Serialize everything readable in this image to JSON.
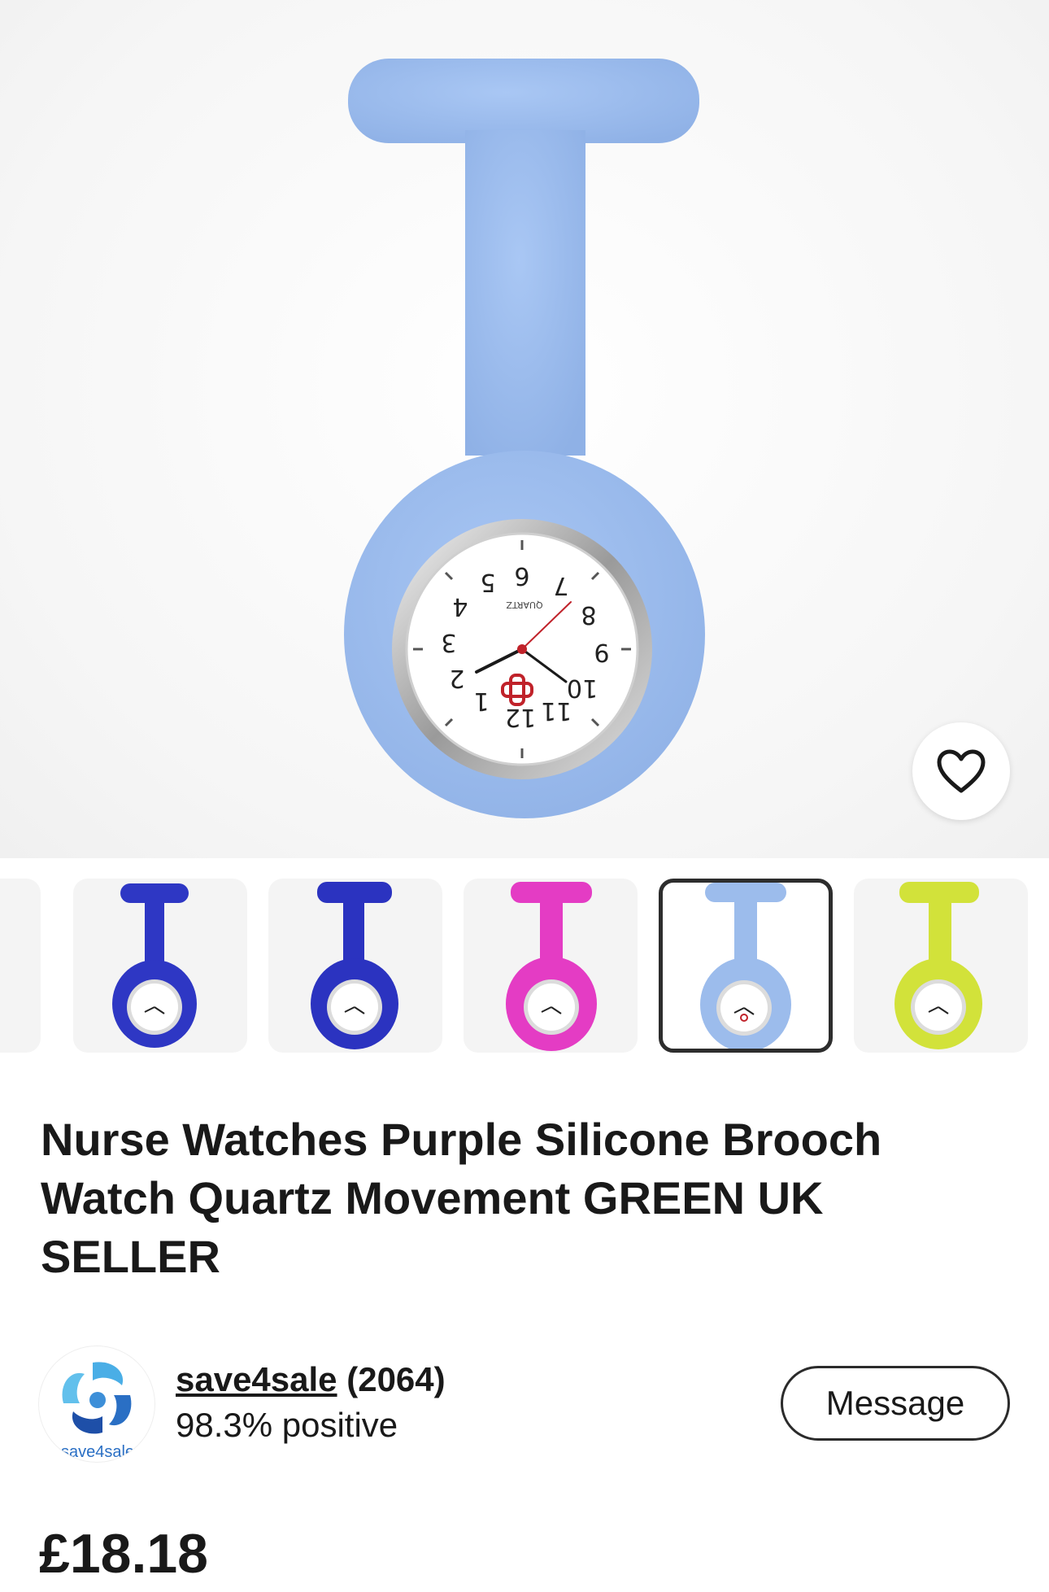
{
  "listing": {
    "title": "Nurse Watches Purple Silicone Brooch Watch Quartz Movement GREEN UK SELLER",
    "price": "£18.18"
  },
  "seller": {
    "name": "save4sale",
    "feedback_count": "(2064)",
    "positive": "98.3% positive",
    "logo_text": "save4sale"
  },
  "actions": {
    "message_label": "Message",
    "favorite_icon": "heart-icon"
  },
  "watch_face": {
    "brand": "QUARTZ"
  },
  "gallery": {
    "thumbnail_colors": [
      "#f4f4f4",
      "#2e37c4",
      "#2b33c0",
      "#e43cc4",
      "#9cbcec",
      "#d2e23a"
    ],
    "selected_index": 4
  },
  "colors": {
    "main_watch": "#9dbdef",
    "text": "#191919",
    "accent_red": "#c0222a"
  }
}
